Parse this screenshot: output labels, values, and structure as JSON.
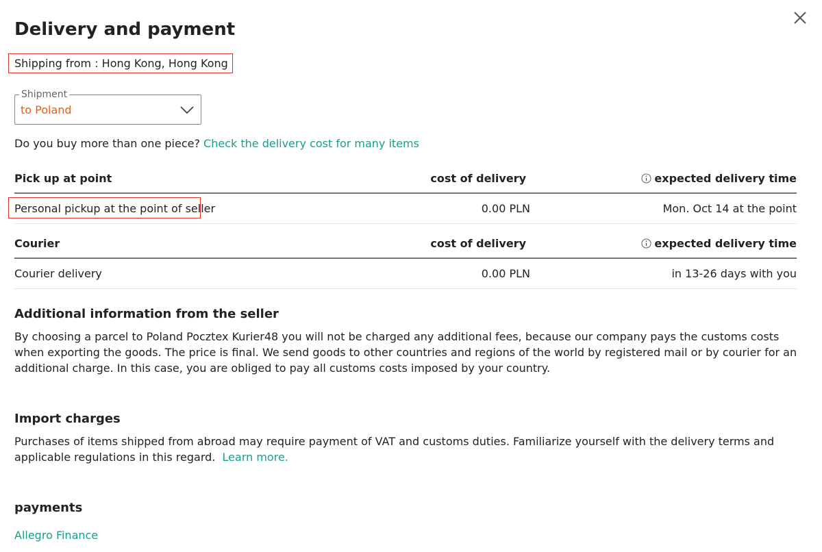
{
  "dialog": {
    "title": "Delivery and payment",
    "close_icon": "close-icon"
  },
  "shipping_from": "Shipping from : Hong Kong, Hong Kong",
  "shipment": {
    "label": "Shipment",
    "value": "to Poland",
    "value_color": "#e0601d"
  },
  "question": {
    "text": "Do you buy more than one piece?",
    "link": "Check the delivery cost for many items"
  },
  "tables": [
    {
      "header": {
        "method": "Pick up at point",
        "cost": "cost of delivery",
        "time": "expected delivery time"
      },
      "row": {
        "method": "Personal pickup at the point of seller",
        "cost": "0.00 PLN",
        "time": "Mon. Oct 14 at the point"
      }
    },
    {
      "header": {
        "method": "Courier",
        "cost": "cost of delivery",
        "time": "expected delivery time"
      },
      "row": {
        "method": "Courier delivery",
        "cost": "0.00 PLN",
        "time": "in 13-26 days with you"
      }
    }
  ],
  "additional_info": {
    "title": "Additional information from the seller",
    "text": "By choosing a parcel to Poland Pocztex Kurier48 you will not be charged any additional fees, because our company pays the customs costs when exporting the goods. The price is final. We send goods to other countries and regions of the world by registered mail or by courier for an additional charge. In this case, you are obliged to pay all customs costs imposed by your country."
  },
  "import_charges": {
    "title": "Import charges",
    "text": "Purchases of items shipped from abroad may require payment of VAT and customs duties. Familiarize yourself with the delivery terms and applicable regulations in this regard.",
    "link": "Learn more."
  },
  "payments": {
    "title": "payments",
    "link": "Allegro Finance"
  },
  "colors": {
    "link": "#1a9d8a",
    "highlight_border": "#d6332b",
    "accent_orange": "#e0601d"
  }
}
